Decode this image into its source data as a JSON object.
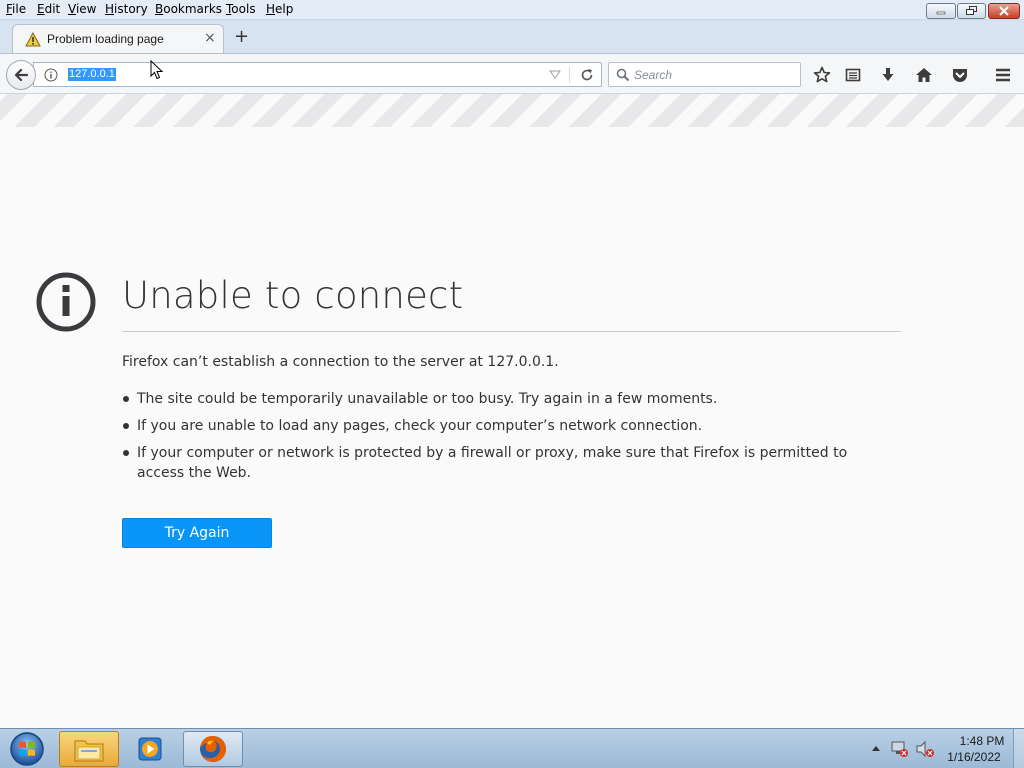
{
  "menubar": {
    "items": [
      {
        "label": "File"
      },
      {
        "label": "Edit"
      },
      {
        "label": "View"
      },
      {
        "label": "History"
      },
      {
        "label": "Bookmarks"
      },
      {
        "label": "Tools"
      },
      {
        "label": "Help"
      }
    ]
  },
  "tab": {
    "title": "Problem loading page",
    "close_glyph": "×",
    "icon": "warning-icon"
  },
  "newtab": {
    "glyph": "+"
  },
  "navbar": {
    "url": "127.0.0.1",
    "search_placeholder": "Search",
    "icons": [
      "back-arrow-icon",
      "info-icon",
      "dropdown-icon",
      "reload-icon",
      "search-icon",
      "star-icon",
      "reading-list-icon",
      "download-icon",
      "home-icon",
      "pocket-icon",
      "hamburger-menu-icon"
    ]
  },
  "error": {
    "title": "Unable to connect",
    "description": "Firefox can’t establish a connection to the server at 127.0.0.1.",
    "bullets": [
      "The site could be temporarily unavailable or too busy. Try again in a few moments.",
      "If you are unable to load any pages, check your computer’s network connection.",
      "If your computer or network is protected by a firewall or proxy, make sure that Firefox is permitted to access the Web."
    ],
    "button_label": "Try Again"
  },
  "taskbar": {
    "time": "1:48 PM",
    "date": "1/16/2022",
    "apps": [
      "windows-explorer",
      "media-player",
      "firefox"
    ]
  },
  "colors": {
    "accent": "#0996f8",
    "url_selection": "#3399ff",
    "title_text": "#333333"
  }
}
